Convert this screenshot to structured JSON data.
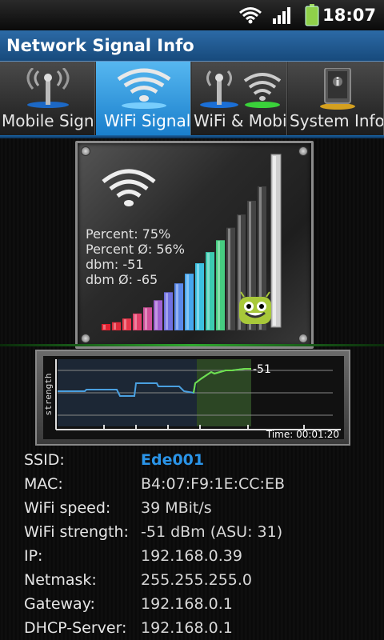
{
  "status_bar": {
    "time": "18:07",
    "icons": [
      "wifi-icon",
      "signal-bars-icon",
      "battery-icon"
    ]
  },
  "app": {
    "title": "Network Signal Info"
  },
  "tabs": [
    {
      "label": "Mobile Signal",
      "icon": "cell-tower-icon",
      "active": false
    },
    {
      "label": "WiFi Signal",
      "icon": "wifi-icon",
      "active": true
    },
    {
      "label": "WiFi & Mobile",
      "icon": "tower-and-wifi-icon",
      "active": false
    },
    {
      "label": "System Info",
      "icon": "phone-info-icon",
      "active": false
    }
  ],
  "signal": {
    "percent": "Percent: 75%",
    "percent_avg": "Percent Ø: 56%",
    "dbm": "dbm: -51",
    "dbm_avg": "dbm Ø: -65",
    "level_fraction": 0.75
  },
  "graph": {
    "ylabel": "strength",
    "current_value": "-51",
    "time": "Time: 00:01:20"
  },
  "info": [
    {
      "key": "SSID:",
      "value": "Ede001"
    },
    {
      "key": "MAC:",
      "value": "B4:07:F9:1E:CC:EB"
    },
    {
      "key": "WiFi speed:",
      "value": "39 MBit/s"
    },
    {
      "key": "WiFi strength:",
      "value": "-51 dBm (ASU: 31)"
    },
    {
      "key": "IP:",
      "value": "192.168.0.39"
    },
    {
      "key": "Netmask:",
      "value": "255.255.255.0"
    },
    {
      "key": "Gateway:",
      "value": "192.168.0.1"
    },
    {
      "key": "DHCP-Server:",
      "value": "192.168.0.1"
    }
  ],
  "colors": {
    "accent_blue": "#2a94e8",
    "tab_active": "#1a7fcc",
    "graph_line": "#6fe04a"
  }
}
